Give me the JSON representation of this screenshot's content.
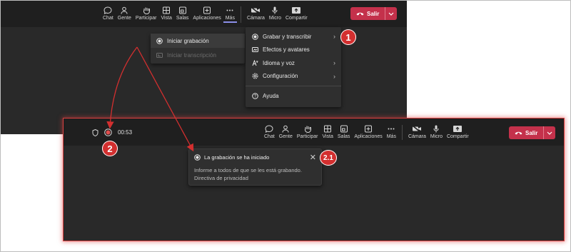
{
  "toolbar": {
    "items": [
      {
        "label": "Chat",
        "icon": "chat-icon"
      },
      {
        "label": "Gente",
        "icon": "people-icon"
      },
      {
        "label": "Participar",
        "icon": "raise-hand-icon"
      },
      {
        "label": "Vista",
        "icon": "view-grid-icon"
      },
      {
        "label": "Salas",
        "icon": "rooms-icon"
      },
      {
        "label": "Aplicaciones",
        "icon": "apps-plus-icon"
      },
      {
        "label": "Más",
        "icon": "more-icon"
      }
    ],
    "device_items": [
      {
        "label": "Cámara",
        "icon": "camera-off-icon"
      },
      {
        "label": "Micro",
        "icon": "microphone-icon"
      },
      {
        "label": "Compartir",
        "icon": "share-icon"
      }
    ],
    "leave_label": "Salir"
  },
  "submenu": {
    "items": [
      {
        "label": "Iniciar grabación",
        "enabled": true
      },
      {
        "label": "Iniciar transcripción",
        "enabled": false
      }
    ]
  },
  "more_menu": {
    "items": [
      {
        "label": "Grabar y transcribir",
        "icon": "record-icon",
        "has_submenu": true
      },
      {
        "label": "Efectos y avatares",
        "icon": "effects-icon",
        "has_submenu": false
      },
      {
        "label": "Idioma y voz",
        "icon": "language-icon",
        "has_submenu": true
      },
      {
        "label": "Configuración",
        "icon": "settings-icon",
        "has_submenu": true
      },
      {
        "label": "Ayuda",
        "icon": "help-icon",
        "has_submenu": false
      }
    ]
  },
  "recording": {
    "timer": "00:53"
  },
  "toast": {
    "title": "La grabación se ha iniciado",
    "line1": "Informe a todos de que se les está grabando.",
    "line2": "Directiva de privacidad"
  },
  "badges": {
    "b1": "1",
    "b2": "2",
    "b21": "2.1"
  },
  "colors": {
    "background": "#292929",
    "toolbar": "#1f1f1f",
    "leave_button": "#c4314b",
    "accent": "#8b8fe8",
    "badge": "#d32f2f",
    "arrow": "#d32f2f"
  }
}
